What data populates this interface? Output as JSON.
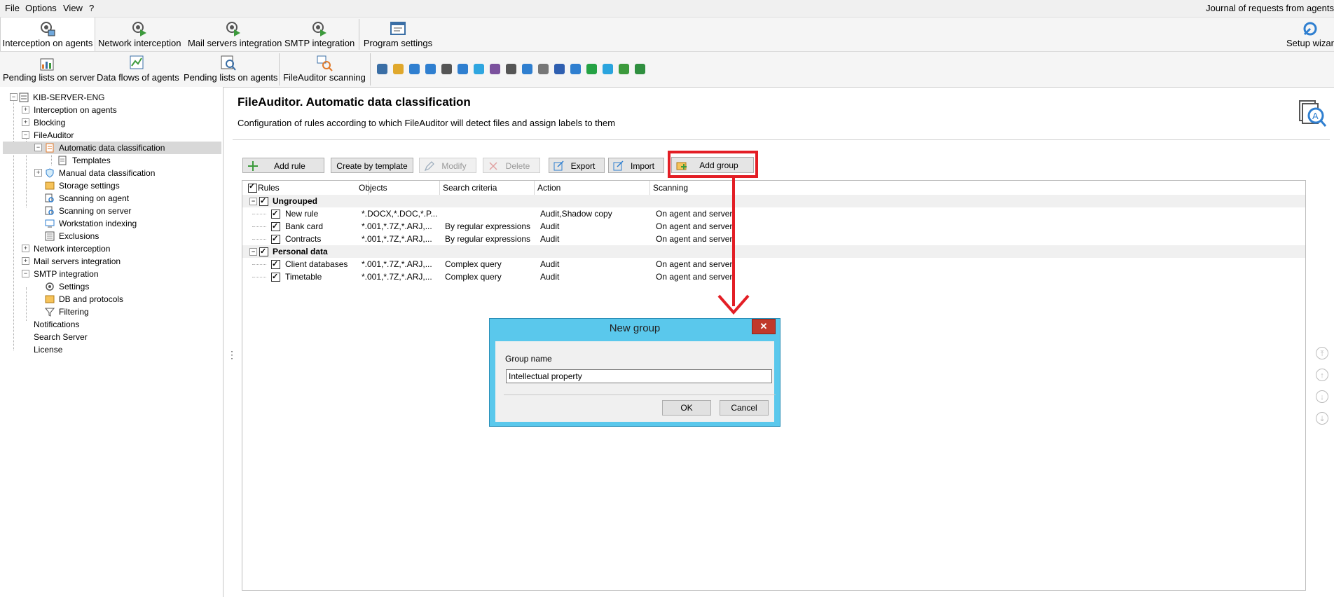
{
  "menu": {
    "file": "File",
    "options": "Options",
    "view": "View",
    "help": "?",
    "journal": "Journal of requests from agents"
  },
  "toolbar1": {
    "interception_on_agents": "Interception on agents",
    "network_interception": "Network interception",
    "mail_servers_integration": "Mail servers integration",
    "smtp_integration": "SMTP integration",
    "program_settings": "Program settings",
    "setup_wizard": "Setup wizard"
  },
  "toolbar2": {
    "pending_lists_on_server": "Pending lists on server",
    "data_flows_of_agents": "Data flows of agents",
    "pending_lists_on_agents": "Pending lists on agents",
    "fileauditor_scanning": "FileAuditor scanning"
  },
  "channel_icons": [
    "usb-icon",
    "mail-icon",
    "http-icon",
    "web-icon",
    "keyboard-icon",
    "monitor-icon",
    "skype-icon",
    "viber-icon",
    "printer-icon",
    "microphone-icon",
    "clock-icon",
    "lync-icon",
    "webcam-icon",
    "whatsapp-icon",
    "telegram-icon",
    "icq-icon",
    "gear-icon"
  ],
  "tree": {
    "root": "KIB-SERVER-ENG",
    "interception_on_agents": "Interception on agents",
    "blocking": "Blocking",
    "fileauditor": "FileAuditor",
    "automatic_data_classification": "Automatic data classification",
    "templates": "Templates",
    "manual_data_classification": "Manual data classification",
    "storage_settings": "Storage settings",
    "scanning_on_agent": "Scanning on agent",
    "scanning_on_server": "Scanning on server",
    "workstation_indexing": "Workstation indexing",
    "exclusions": "Exclusions",
    "network_interception": "Network interception",
    "mail_servers_integration": "Mail servers integration",
    "smtp_integration": "SMTP integration",
    "settings": "Settings",
    "db_and_protocols": "DB and protocols",
    "filtering": "Filtering",
    "notifications": "Notifications",
    "search_server": "Search Server",
    "license": "License"
  },
  "main": {
    "title": "FileAuditor. Automatic data classification",
    "description": "Configuration of rules according to which FileAuditor will detect files and assign labels to them"
  },
  "actions": {
    "add_rule": "Add rule",
    "create_by_template": "Create by template",
    "modify": "Modify",
    "delete": "Delete",
    "export": "Export",
    "import": "Import",
    "add_group": "Add group"
  },
  "grid": {
    "headers": {
      "rules": "Rules",
      "objects": "Objects",
      "search_criteria": "Search criteria",
      "action": "Action",
      "scanning": "Scanning"
    },
    "groups": [
      {
        "name": "Ungrouped",
        "rows": [
          {
            "rule": "New rule",
            "objects": "*.DOCX,*.DOC,*.P...",
            "criteria": "",
            "action": "Audit,Shadow copy",
            "scanning": "On agent and server"
          },
          {
            "rule": "Bank card",
            "objects": "*.001,*.7Z,*.ARJ,...",
            "criteria": "By regular expressions",
            "action": "Audit",
            "scanning": "On agent and server"
          },
          {
            "rule": "Contracts",
            "objects": "*.001,*.7Z,*.ARJ,...",
            "criteria": "By regular expressions",
            "action": "Audit",
            "scanning": "On agent and server"
          }
        ]
      },
      {
        "name": "Personal data",
        "rows": [
          {
            "rule": "Client databases",
            "objects": "*.001,*.7Z,*.ARJ,...",
            "criteria": "Complex query",
            "action": "Audit",
            "scanning": "On agent and server"
          },
          {
            "rule": "Timetable",
            "objects": "*.001,*.7Z,*.ARJ,...",
            "criteria": "Complex query",
            "action": "Audit",
            "scanning": "On agent and server"
          }
        ]
      }
    ]
  },
  "dialog": {
    "title": "New group",
    "close": "✕",
    "group_name_label": "Group name",
    "group_name_value": "Intellectual property",
    "ok": "OK",
    "cancel": "Cancel"
  },
  "splitter": "⋮",
  "nav": {
    "top": "⤒",
    "up": "↑",
    "down": "↓",
    "bottom": "⤓"
  },
  "colors": {
    "highlight": "#e31e25",
    "dialog_title": "#5ac8ec",
    "close_button": "#c0392b"
  }
}
